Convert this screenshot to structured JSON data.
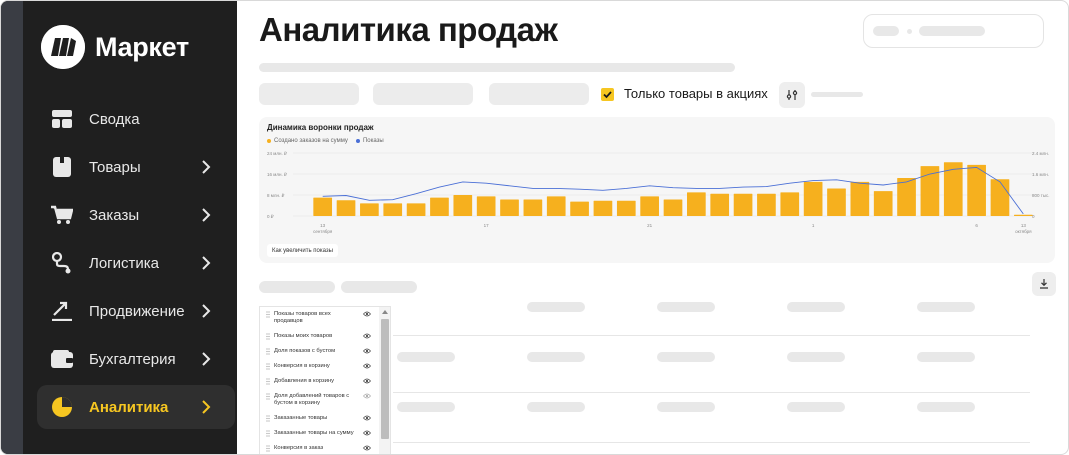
{
  "brand": {
    "name": "Маркет",
    "accent": "#f6c621",
    "sidebar_bg": "#1f1f1f"
  },
  "sidebar": {
    "items": [
      {
        "label": "Сводка",
        "icon": "dashboard-icon",
        "has_chevron": false,
        "active": false
      },
      {
        "label": "Товары",
        "icon": "box-icon",
        "has_chevron": true,
        "active": false
      },
      {
        "label": "Заказы",
        "icon": "cart-icon",
        "has_chevron": true,
        "active": false
      },
      {
        "label": "Логистика",
        "icon": "route-icon",
        "has_chevron": true,
        "active": false
      },
      {
        "label": "Продвижение",
        "icon": "trend-icon",
        "has_chevron": true,
        "active": false
      },
      {
        "label": "Бухгалтерия",
        "icon": "wallet-icon",
        "has_chevron": true,
        "active": false
      },
      {
        "label": "Аналитика",
        "icon": "pie-chart-icon",
        "has_chevron": true,
        "active": true
      }
    ]
  },
  "header": {
    "title": "Аналитика продаж"
  },
  "filters": {
    "promo_only_label": "Только товары в акциях",
    "promo_only_checked": true
  },
  "chart": {
    "title": "Динамика воронки продаж",
    "legend": [
      "Создано заказов на сумму",
      "Показы"
    ],
    "legend_colors": [
      "#f6b01e",
      "#4a6fd6"
    ],
    "hint_button": "Как увеличить показы"
  },
  "chart_data": {
    "type": "bar",
    "left_axis_ticks": [
      "24 млн. ₽",
      "16 млн. ₽",
      "8 млн. ₽",
      "0 ₽"
    ],
    "right_axis_ticks": [
      "2.4 млн.",
      "1.6 млн.",
      "800 тыс.",
      "0"
    ],
    "x_tick_labels": [
      {
        "label": "13",
        "sublabel": "сентября",
        "index": 0
      },
      {
        "label": "17",
        "index": 7
      },
      {
        "label": "21",
        "index": 14
      },
      {
        "label": "1",
        "index": 21
      },
      {
        "label": "6",
        "index": 28
      },
      {
        "label": "13",
        "sublabel": "октября",
        "index": 30
      }
    ],
    "ylim": [
      0,
      24
    ],
    "series": [
      {
        "name": "Создано заказов на сумму",
        "type": "bar",
        "values": [
          7,
          6,
          4.8,
          4.8,
          4.8,
          7,
          8,
          7.5,
          6.3,
          6.3,
          7.5,
          5.5,
          5.8,
          5.8,
          7.5,
          6.3,
          9,
          8.5,
          8.5,
          8.5,
          9,
          13,
          10.5,
          13,
          9.5,
          14.5,
          19,
          20.5,
          19.5,
          14,
          0.5
        ]
      },
      {
        "name": "Показы",
        "type": "line",
        "values": [
          7.5,
          7.8,
          6,
          6.2,
          8.5,
          11,
          13,
          12.5,
          11.5,
          10.5,
          10.5,
          10.2,
          9.8,
          10.5,
          11.5,
          10.8,
          10.5,
          10.5,
          11,
          11.2,
          12.5,
          13.5,
          13.8,
          12.5,
          11.8,
          13,
          16,
          17.8,
          18.5,
          13,
          0.8
        ]
      }
    ]
  },
  "table": {
    "columns_panel": [
      {
        "label": "Показы товаров всех продавцов",
        "visible": true
      },
      {
        "label": "Показы моих товаров",
        "visible": true
      },
      {
        "label": "Доля показов с бустом",
        "visible": true
      },
      {
        "label": "Конверсия в корзину",
        "visible": true
      },
      {
        "label": "Добавления в корзину",
        "visible": true
      },
      {
        "label": "Доля добавлений товаров с бустом в корзину",
        "visible": false
      },
      {
        "label": "Заказанные товары",
        "visible": true
      },
      {
        "label": "Заказанные товары на сумму",
        "visible": true
      },
      {
        "label": "Конверсия в заказ",
        "visible": true
      }
    ]
  }
}
